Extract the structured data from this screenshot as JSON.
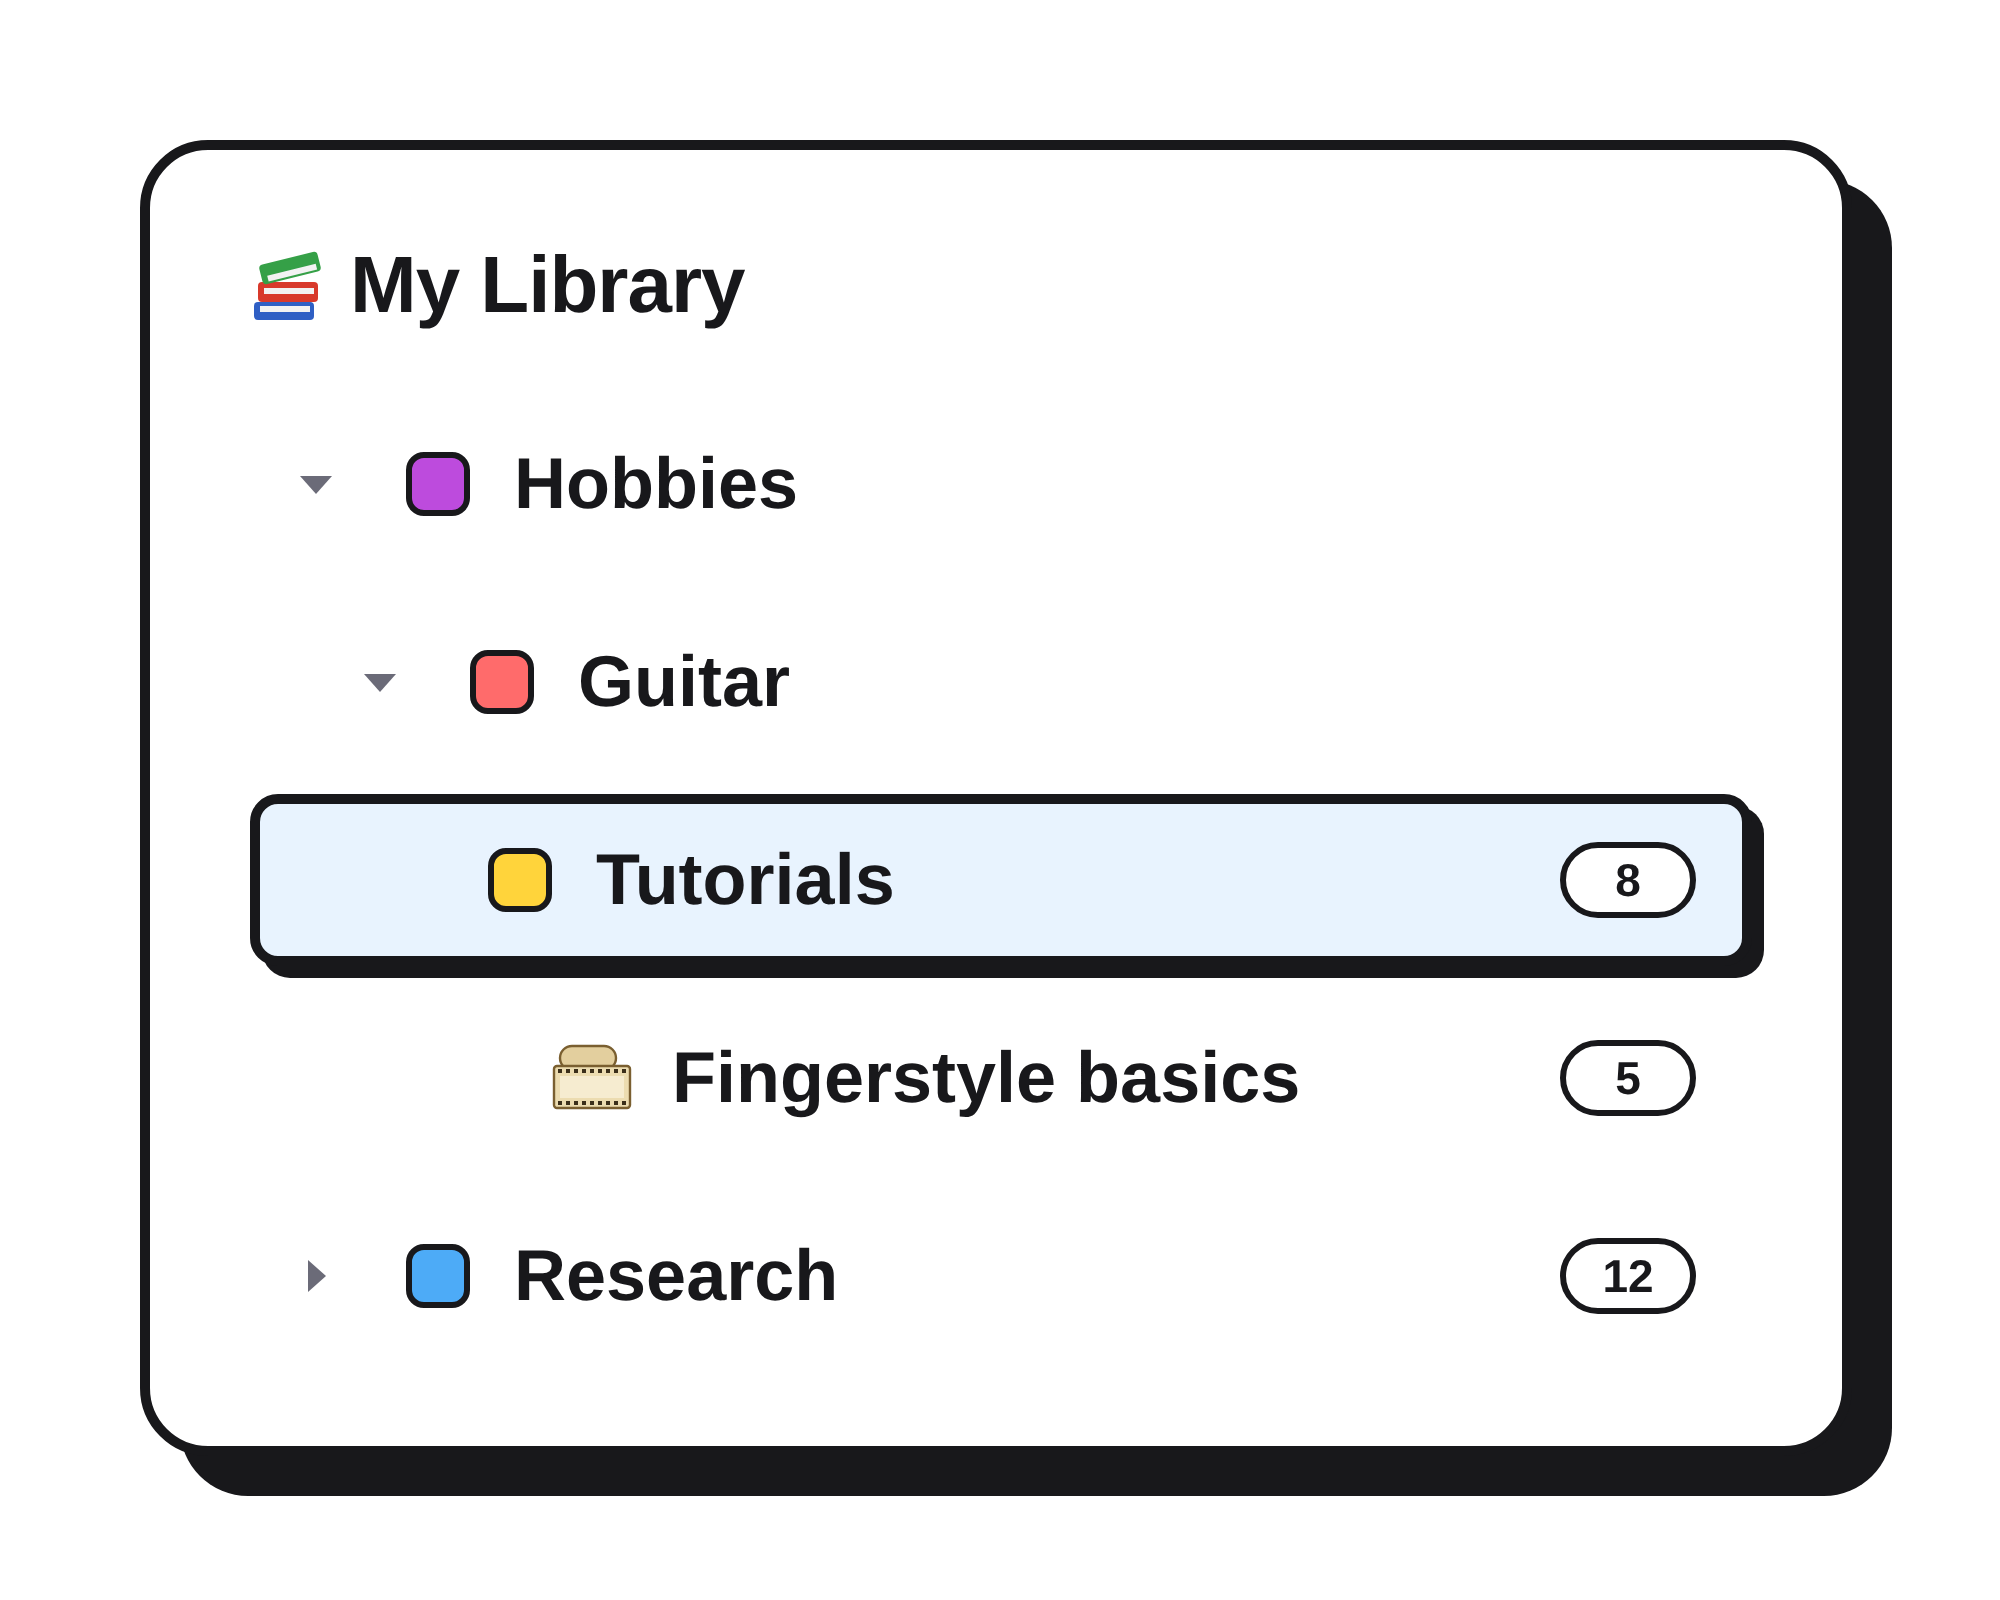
{
  "title": "My Library",
  "tree": [
    {
      "label": "Hobbies",
      "kind": "folder",
      "color": "#bd4bdd",
      "expanded": true,
      "selected": false,
      "children": [
        {
          "label": "Guitar",
          "kind": "folder",
          "color": "#ff6b6b",
          "expanded": true,
          "selected": false,
          "children": [
            {
              "label": "Tutorials",
              "kind": "folder",
              "color": "#ffd43b",
              "selected": true,
              "count": "8",
              "children": [
                {
                  "label": "Fingerstyle basics",
                  "kind": "video",
                  "selected": false,
                  "count": "5"
                }
              ]
            }
          ]
        }
      ]
    },
    {
      "label": "Research",
      "kind": "folder",
      "color": "#4dabf7",
      "expanded": false,
      "selected": false,
      "count": "12"
    }
  ]
}
